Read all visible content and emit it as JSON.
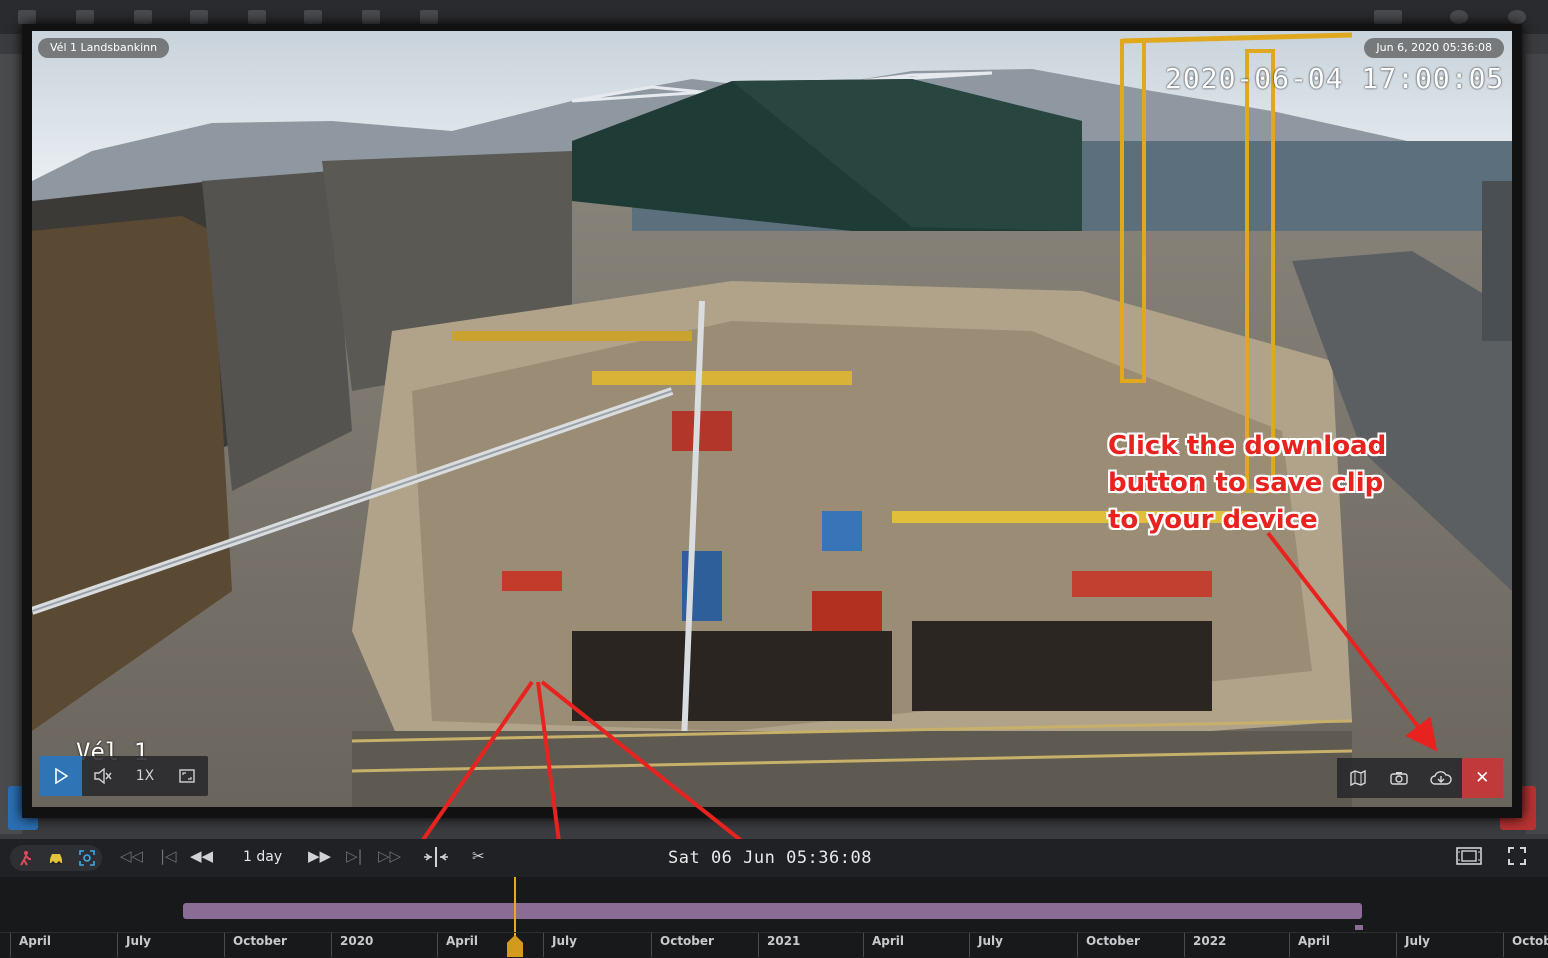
{
  "viewer": {
    "camera_name": "Vél 1 Landsbankinn",
    "snapshot_time": "Jun 6, 2020 05:36:08",
    "osd_timestamp": "2020-06-04 17:00:05",
    "osd_label": "Vél 1",
    "speed": "1X"
  },
  "annotation": {
    "text": "Click the download\nbutton to save clip\nto your device",
    "color": "#e8231f"
  },
  "controls": {
    "step_label": "1 day",
    "timestamp": "Sat 06 Jun  05:36:08",
    "filter_colors": [
      "#e0495a",
      "#e3c23b",
      "#3fa9e8"
    ]
  },
  "timeline": {
    "labels": [
      "April",
      "July",
      "October",
      "2020",
      "April",
      "July",
      "October",
      "2021",
      "April",
      "July",
      "October",
      "2022",
      "April",
      "July",
      "Octob"
    ],
    "bar_color": "#8a6c95",
    "cursor_color": "#e7a822"
  }
}
